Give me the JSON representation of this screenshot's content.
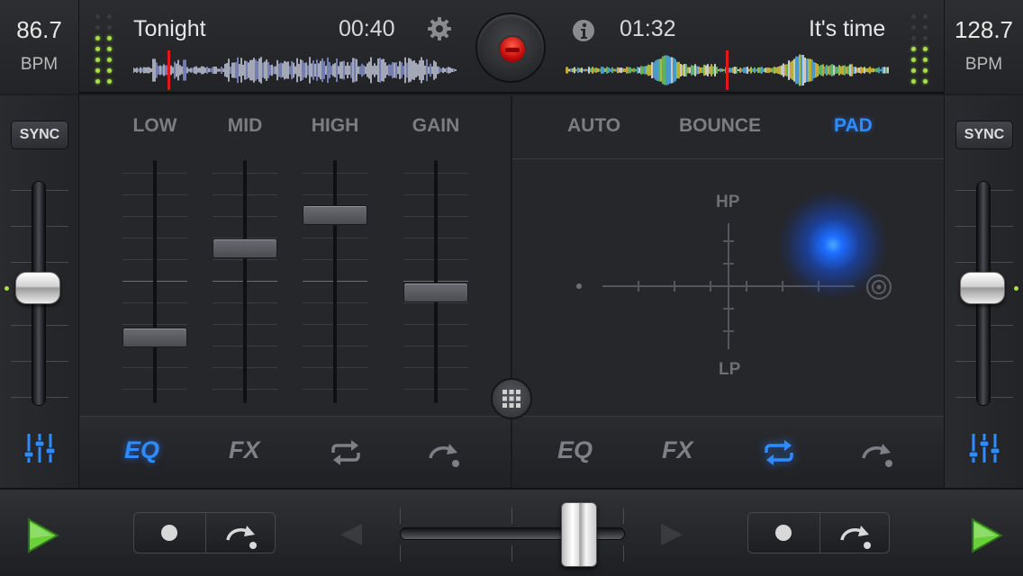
{
  "deck_left": {
    "bpm": "86.7",
    "bpm_label": "BPM",
    "title": "Tonight",
    "time": "00:40",
    "sync_label": "SYNC"
  },
  "deck_right": {
    "bpm": "128.7",
    "bpm_label": "BPM",
    "title": "It's time",
    "time": "01:32",
    "sync_label": "SYNC"
  },
  "eq_panel": {
    "headers": [
      "LOW",
      "MID",
      "HIGH",
      "GAIN"
    ],
    "levels": [
      0.25,
      0.65,
      0.8,
      0.45
    ]
  },
  "pad_panel": {
    "tabs": [
      "AUTO",
      "BOUNCE",
      "PAD"
    ],
    "active_tab": "PAD",
    "hp_label": "HP",
    "lp_label": "LP"
  },
  "tabbar_left": {
    "eq_label": "EQ",
    "fx_label": "FX",
    "active": "EQ"
  },
  "tabbar_right": {
    "eq_label": "EQ",
    "fx_label": "FX",
    "active": "loop"
  },
  "crossfader": {
    "position": 0.85
  },
  "colors": {
    "accent": "#2e8cff",
    "led": "#a8e04a",
    "record": "#d6100f",
    "play": "#6ad03a"
  },
  "icons": {
    "settings": "gear-icon",
    "info": "info-icon",
    "mixer": "mixer-sliders-icon",
    "loop": "loop-icon",
    "redo": "redo-icon",
    "grid": "grid-icon",
    "play": "play-icon"
  }
}
